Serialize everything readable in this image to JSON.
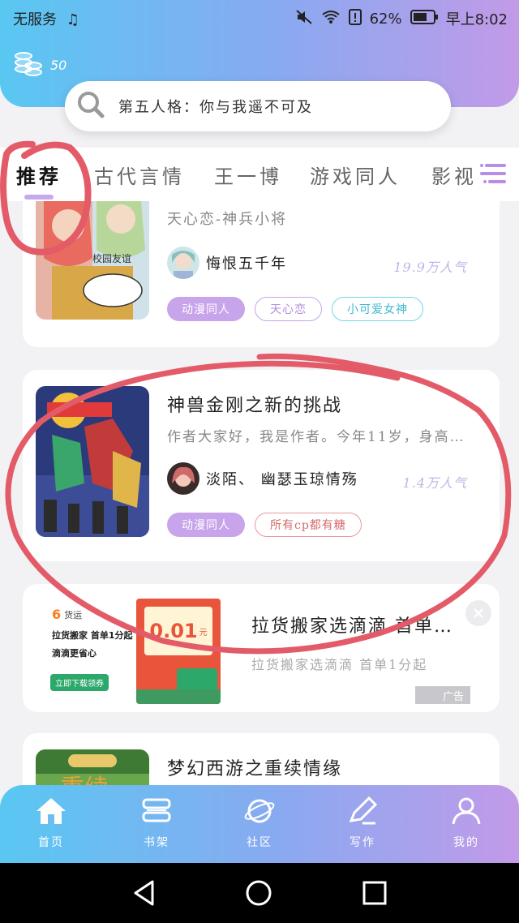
{
  "status_bar": {
    "carrier": "无服务",
    "battery": "62%",
    "time": "早上8:02"
  },
  "coins": {
    "count": "50"
  },
  "search": {
    "placeholder": "第五人格：你与我遥不可及"
  },
  "tabs": [
    {
      "label": "推荐",
      "active": true
    },
    {
      "label": "古代言情",
      "active": false
    },
    {
      "label": "王一博",
      "active": false
    },
    {
      "label": "游戏同人",
      "active": false
    },
    {
      "label": "影视",
      "active": false
    }
  ],
  "cards": [
    {
      "title": "天心恋-神兵小将",
      "cover_caption": "校园友谊",
      "author": "悔恨五千年",
      "popularity": "19.9万人气",
      "tags": [
        "动漫同人",
        "天心恋",
        "小可爱女神"
      ]
    },
    {
      "title": "神兽金刚之新的挑战",
      "description": "作者大家好，我是作者。今年11岁，身高…",
      "author": "淡陌、 幽瑟玉琼情殇",
      "popularity": "1.4万人气",
      "tags": [
        "动漫同人",
        "所有cp都有糖"
      ]
    }
  ],
  "ad": {
    "brand": "货运",
    "line1": "拉货搬家 首单1分起",
    "line2": "滴滴更省心",
    "cta": "立即下载领券",
    "coupon": "0.01",
    "coupon_unit": "元",
    "title": "拉货搬家选滴滴 首单1…",
    "desc": "拉货搬家选滴滴 首单1分起",
    "badge": "广告"
  },
  "card3": {
    "title": "梦幻西游之重续情缘"
  },
  "bottom_nav": [
    {
      "label": "首页",
      "icon": "home-icon"
    },
    {
      "label": "书架",
      "icon": "bookshelf-icon"
    },
    {
      "label": "社区",
      "icon": "planet-icon"
    },
    {
      "label": "写作",
      "icon": "pen-icon"
    },
    {
      "label": "我的",
      "icon": "user-icon"
    }
  ],
  "colors": {
    "accent_purple": "#c8a4ea",
    "header_start": "#59c7f2",
    "header_end": "#c29ae8",
    "annotation_red": "#e35b68"
  }
}
